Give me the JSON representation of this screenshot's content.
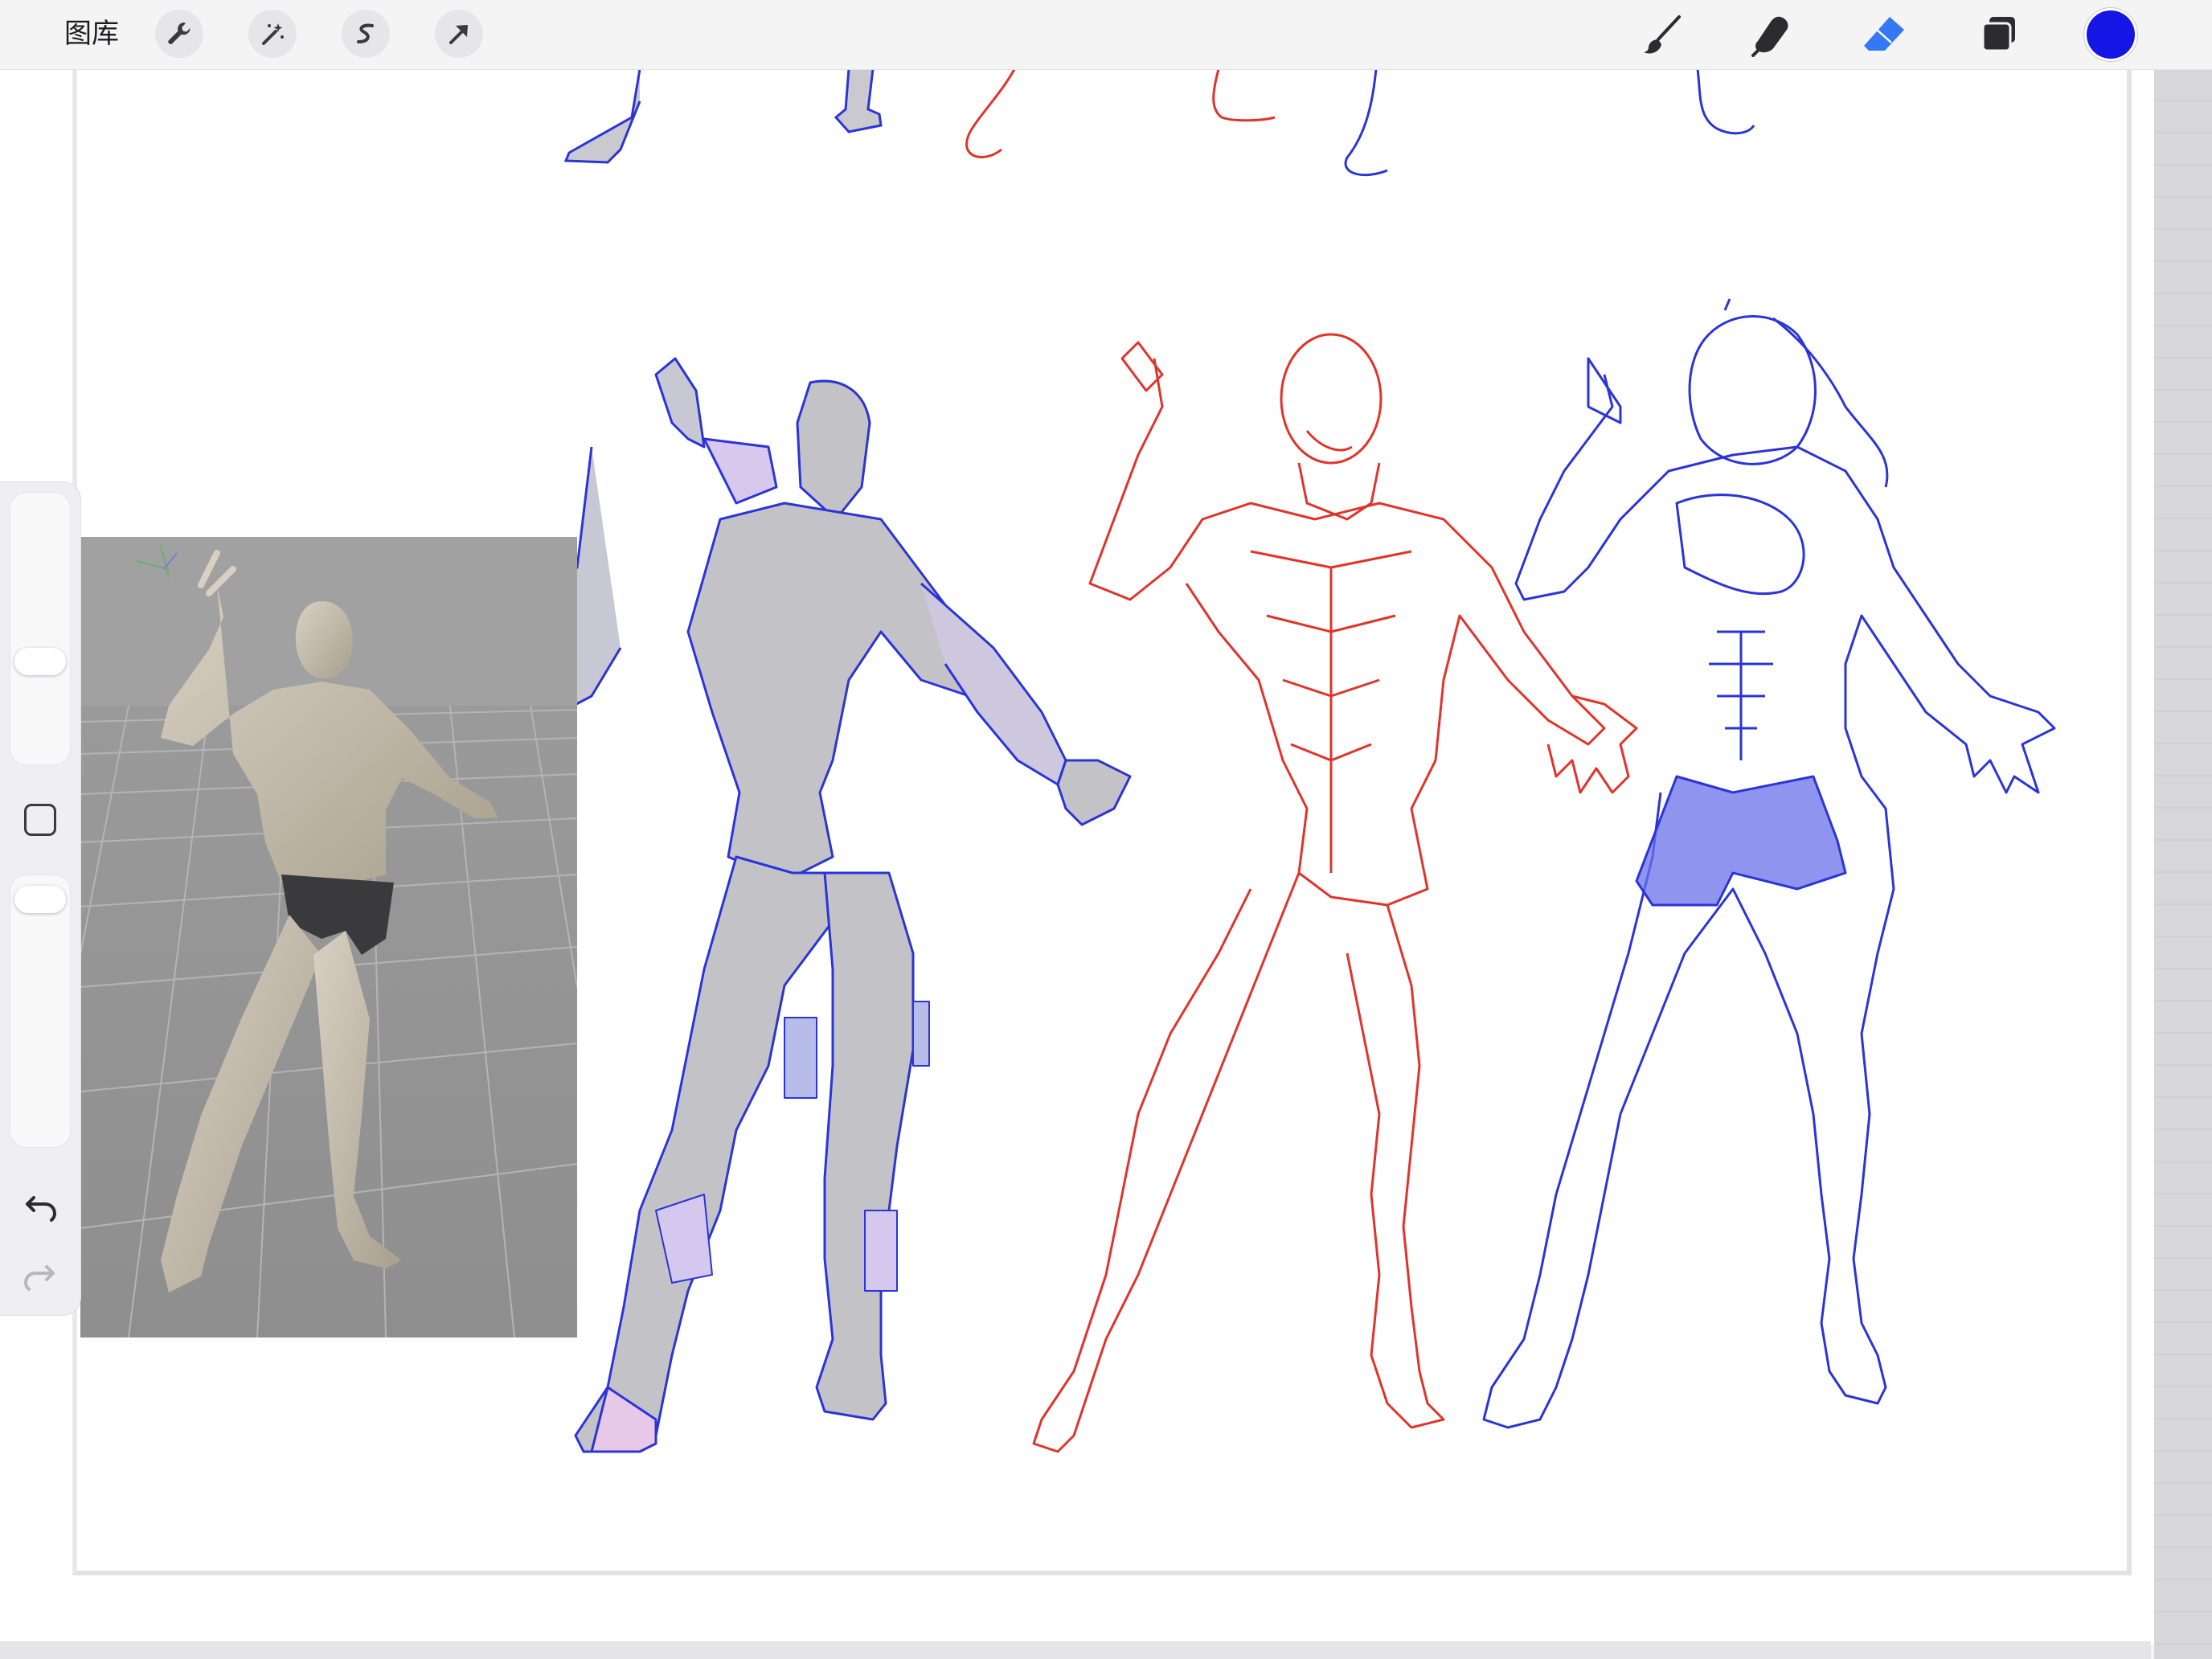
{
  "toolbar": {
    "gallery_label": "图库",
    "left_tools": [
      {
        "name": "actions",
        "icon": "wrench-icon"
      },
      {
        "name": "adjustments",
        "icon": "magic-wand-icon"
      },
      {
        "name": "selection",
        "icon": "selection-s-icon"
      },
      {
        "name": "transform",
        "icon": "arrow-cursor-icon"
      }
    ],
    "right_tools": [
      {
        "name": "brush",
        "icon": "brush-icon"
      },
      {
        "name": "smudge",
        "icon": "smudge-finger-icon"
      },
      {
        "name": "eraser",
        "icon": "eraser-icon",
        "active": true
      },
      {
        "name": "layers",
        "icon": "layers-icon"
      }
    ],
    "current_color": "#1515e6"
  },
  "sidebar": {
    "brush_size_icon": "slider-thumb",
    "opacity_icon": "slider-thumb",
    "modify_icon": "square-modify-icon",
    "undo_icon": "undo-icon",
    "redo_icon": "redo-icon"
  },
  "colors": {
    "accent_blue": "#1515e6",
    "sketch_red": "#e0342a",
    "sketch_blue": "#2a34d8",
    "eraser_active": "#3478f6"
  }
}
